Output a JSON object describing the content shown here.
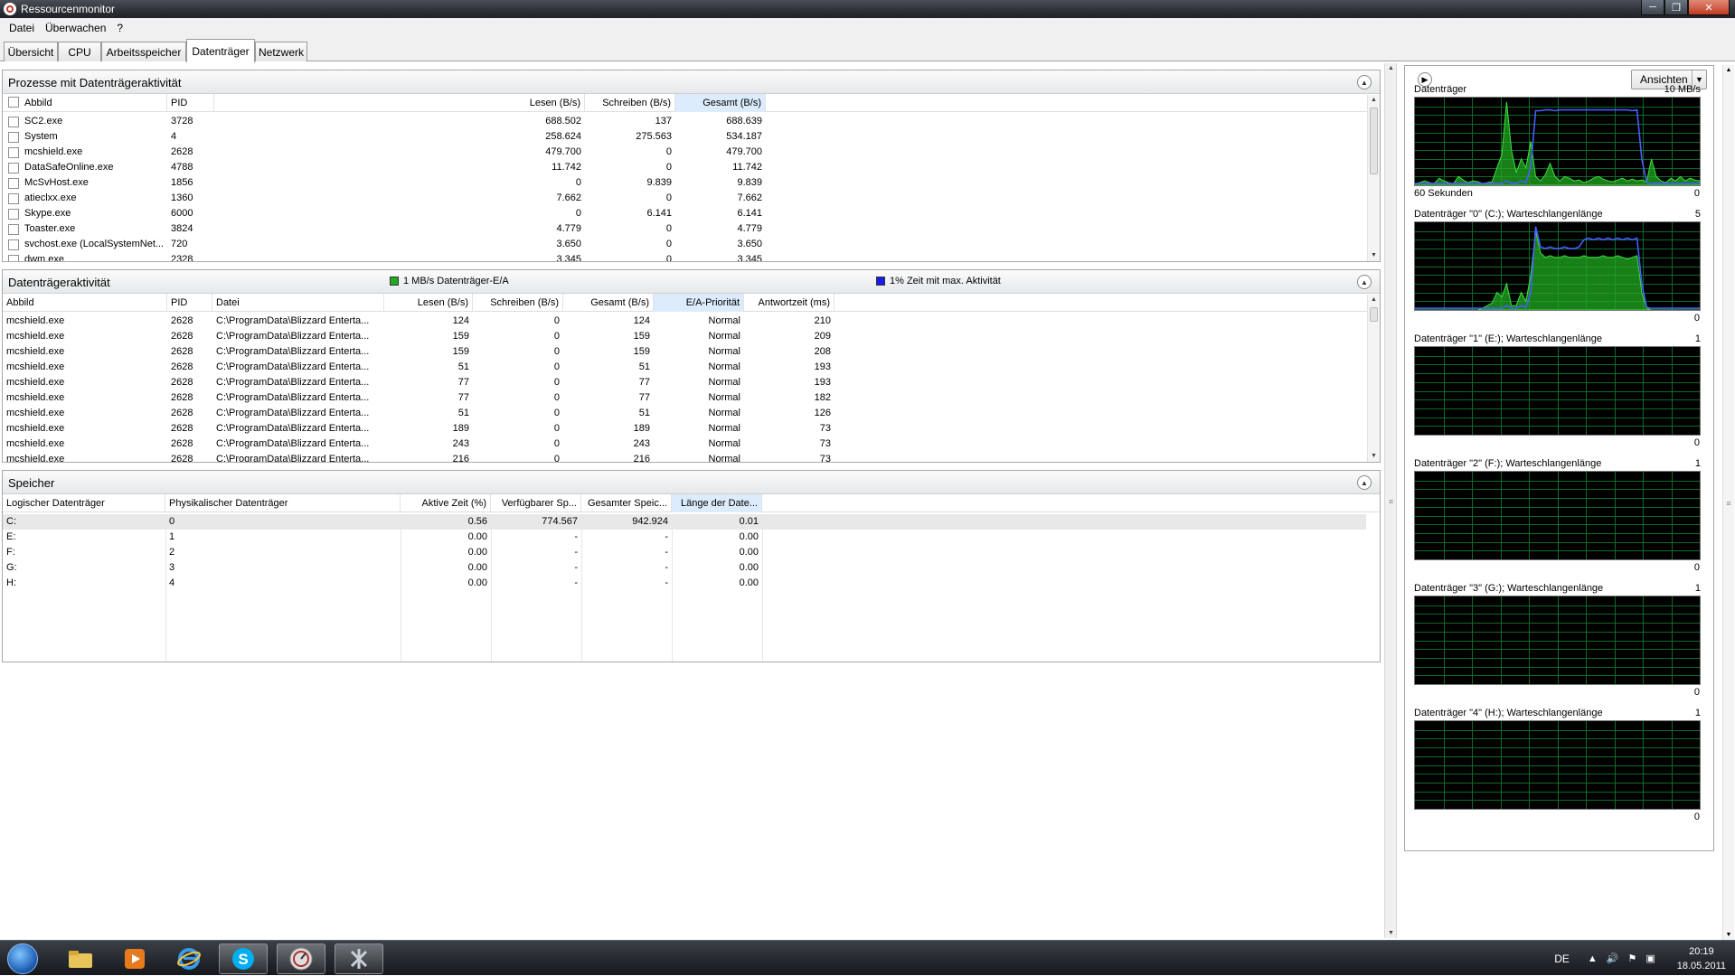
{
  "window": {
    "title": "Ressourcenmonitor"
  },
  "menu": [
    "Datei",
    "Überwachen",
    "?"
  ],
  "tabs": [
    {
      "label": "Übersicht",
      "active": false
    },
    {
      "label": "CPU",
      "active": false
    },
    {
      "label": "Arbeitsspeicher",
      "active": false
    },
    {
      "label": "Datenträger",
      "active": true
    },
    {
      "label": "Netzwerk",
      "active": false
    }
  ],
  "processes": {
    "title": "Prozesse mit Datenträgeraktivität",
    "columns": [
      "Abbild",
      "PID",
      "Lesen (B/s)",
      "Schreiben (B/s)",
      "Gesamt (B/s)"
    ],
    "rows": [
      {
        "name": "SC2.exe",
        "pid": "3728",
        "read": "688.502",
        "write": "137",
        "total": "688.639"
      },
      {
        "name": "System",
        "pid": "4",
        "read": "258.624",
        "write": "275.563",
        "total": "534.187"
      },
      {
        "name": "mcshield.exe",
        "pid": "2628",
        "read": "479.700",
        "write": "0",
        "total": "479.700"
      },
      {
        "name": "DataSafeOnline.exe",
        "pid": "4788",
        "read": "11.742",
        "write": "0",
        "total": "11.742"
      },
      {
        "name": "McSvHost.exe",
        "pid": "1856",
        "read": "0",
        "write": "9.839",
        "total": "9.839"
      },
      {
        "name": "atieclxx.exe",
        "pid": "1360",
        "read": "7.662",
        "write": "0",
        "total": "7.662"
      },
      {
        "name": "Skype.exe",
        "pid": "6000",
        "read": "0",
        "write": "6.141",
        "total": "6.141"
      },
      {
        "name": "Toaster.exe",
        "pid": "3824",
        "read": "4.779",
        "write": "0",
        "total": "4.779"
      },
      {
        "name": "svchost.exe (LocalSystemNet...",
        "pid": "720",
        "read": "3.650",
        "write": "0",
        "total": "3.650"
      },
      {
        "name": "dwm.exe",
        "pid": "2328",
        "read": "3.345",
        "write": "0",
        "total": "3.345"
      }
    ]
  },
  "activity": {
    "title": "Datenträgeraktivität",
    "legend_io": "1 MB/s Datenträger-E/A",
    "legend_active": "1% Zeit mit max. Aktivität",
    "color_io": "#22aa22",
    "color_active": "#1a1aee",
    "columns": [
      "Abbild",
      "PID",
      "Datei",
      "Lesen (B/s)",
      "Schreiben (B/s)",
      "Gesamt (B/s)",
      "E/A-Priorität",
      "Antwortzeit (ms)"
    ],
    "rows": [
      {
        "name": "mcshield.exe",
        "pid": "2628",
        "file": "C:\\ProgramData\\Blizzard Enterta...",
        "read": "124",
        "write": "0",
        "total": "124",
        "prio": "Normal",
        "resp": "210"
      },
      {
        "name": "mcshield.exe",
        "pid": "2628",
        "file": "C:\\ProgramData\\Blizzard Enterta...",
        "read": "159",
        "write": "0",
        "total": "159",
        "prio": "Normal",
        "resp": "209"
      },
      {
        "name": "mcshield.exe",
        "pid": "2628",
        "file": "C:\\ProgramData\\Blizzard Enterta...",
        "read": "159",
        "write": "0",
        "total": "159",
        "prio": "Normal",
        "resp": "208"
      },
      {
        "name": "mcshield.exe",
        "pid": "2628",
        "file": "C:\\ProgramData\\Blizzard Enterta...",
        "read": "51",
        "write": "0",
        "total": "51",
        "prio": "Normal",
        "resp": "193"
      },
      {
        "name": "mcshield.exe",
        "pid": "2628",
        "file": "C:\\ProgramData\\Blizzard Enterta...",
        "read": "77",
        "write": "0",
        "total": "77",
        "prio": "Normal",
        "resp": "193"
      },
      {
        "name": "mcshield.exe",
        "pid": "2628",
        "file": "C:\\ProgramData\\Blizzard Enterta...",
        "read": "77",
        "write": "0",
        "total": "77",
        "prio": "Normal",
        "resp": "182"
      },
      {
        "name": "mcshield.exe",
        "pid": "2628",
        "file": "C:\\ProgramData\\Blizzard Enterta...",
        "read": "51",
        "write": "0",
        "total": "51",
        "prio": "Normal",
        "resp": "126"
      },
      {
        "name": "mcshield.exe",
        "pid": "2628",
        "file": "C:\\ProgramData\\Blizzard Enterta...",
        "read": "189",
        "write": "0",
        "total": "189",
        "prio": "Normal",
        "resp": "73"
      },
      {
        "name": "mcshield.exe",
        "pid": "2628",
        "file": "C:\\ProgramData\\Blizzard Enterta...",
        "read": "243",
        "write": "0",
        "total": "243",
        "prio": "Normal",
        "resp": "73"
      },
      {
        "name": "mcshield.exe",
        "pid": "2628",
        "file": "C:\\ProgramData\\Blizzard Enterta...",
        "read": "216",
        "write": "0",
        "total": "216",
        "prio": "Normal",
        "resp": "73"
      }
    ]
  },
  "storage": {
    "title": "Speicher",
    "columns": [
      "Logischer Datenträger",
      "Physikalischer Datenträger",
      "Aktive Zeit (%)",
      "Verfügbarer Sp...",
      "Gesamter Speic...",
      "Länge der Date..."
    ],
    "rows": [
      {
        "logical": "C:",
        "physical": "0",
        "active": "0.56",
        "free": "774.567",
        "total": "942.924",
        "queue": "0.01"
      },
      {
        "logical": "E:",
        "physical": "1",
        "active": "0.00",
        "free": "-",
        "total": "-",
        "queue": "0.00"
      },
      {
        "logical": "F:",
        "physical": "2",
        "active": "0.00",
        "free": "-",
        "total": "-",
        "queue": "0.00"
      },
      {
        "logical": "G:",
        "physical": "3",
        "active": "0.00",
        "free": "-",
        "total": "-",
        "queue": "0.00"
      },
      {
        "logical": "H:",
        "physical": "4",
        "active": "0.00",
        "free": "-",
        "total": "-",
        "queue": "0.00"
      }
    ]
  },
  "sidebar": {
    "view_button": "Ansichten",
    "graphs": [
      {
        "title": "Datenträger",
        "max": "10 MB/s",
        "footer_left": "60 Sekunden",
        "footer_right": "0",
        "green": [
          0.02,
          0.03,
          0.05,
          0.03,
          0.02,
          0.08,
          0.05,
          0.03,
          0.02,
          0.1,
          0.06,
          0.03,
          0.05,
          0.04,
          0.02,
          0.03,
          0.04,
          0.2,
          0.35,
          0.95,
          0.4,
          0.15,
          0.3,
          0.2,
          0.5,
          0.1,
          0.05,
          0.12,
          0.25,
          0.1,
          0.05,
          0.1,
          0.08,
          0.05,
          0.06,
          0.03,
          0.05,
          0.08,
          0.1,
          0.07,
          0.05,
          0.04,
          0.06,
          0.08,
          0.05,
          0.07,
          0.05,
          0.06,
          0.04,
          0.3,
          0.1,
          0.05,
          0.03,
          0.08,
          0.05,
          0.1,
          0.05,
          0.08,
          0.06,
          0.05
        ],
        "blue": [
          0.02,
          0.02,
          0.02,
          0.02,
          0.02,
          0.02,
          0.02,
          0.02,
          0.02,
          0.02,
          0.02,
          0.02,
          0.02,
          0.02,
          0.02,
          0.02,
          0.02,
          0.02,
          0.02,
          0.05,
          0.02,
          0.02,
          0.05,
          0.03,
          0.2,
          0.85,
          0.85,
          0.86,
          0.86,
          0.85,
          0.86,
          0.86,
          0.86,
          0.86,
          0.86,
          0.86,
          0.86,
          0.86,
          0.86,
          0.86,
          0.86,
          0.86,
          0.86,
          0.86,
          0.86,
          0.85,
          0.86,
          0.3,
          0.03,
          0.02,
          0.02,
          0.02,
          0.02,
          0.02,
          0.02,
          0.02,
          0.02,
          0.02,
          0.02,
          0.02
        ]
      },
      {
        "title": "Datenträger \"0\" (C:); Warteschlangenlänge",
        "max": "5",
        "footer_left": "",
        "footer_right": "0",
        "green": [
          0,
          0,
          0,
          0,
          0,
          0,
          0,
          0,
          0,
          0,
          0,
          0,
          0,
          0,
          0.02,
          0.05,
          0.08,
          0.2,
          0.15,
          0.3,
          0.05,
          0.05,
          0.2,
          0.1,
          0.4,
          0.9,
          0.65,
          0.6,
          0.62,
          0.6,
          0.6,
          0.62,
          0.6,
          0.6,
          0.6,
          0.62,
          0.6,
          0.6,
          0.6,
          0.62,
          0.6,
          0.6,
          0.62,
          0.6,
          0.58,
          0.6,
          0.62,
          0.2,
          0.02,
          0,
          0,
          0,
          0,
          0,
          0,
          0,
          0,
          0,
          0,
          0
        ],
        "blue": [
          0.02,
          0.02,
          0.02,
          0.02,
          0.02,
          0.02,
          0.02,
          0.02,
          0.02,
          0.02,
          0.02,
          0.02,
          0.02,
          0.02,
          0.02,
          0.02,
          0.02,
          0.02,
          0.02,
          0.05,
          0.02,
          0.02,
          0.05,
          0.03,
          0.2,
          0.95,
          0.72,
          0.7,
          0.72,
          0.7,
          0.7,
          0.72,
          0.7,
          0.7,
          0.72,
          0.8,
          0.82,
          0.8,
          0.82,
          0.8,
          0.82,
          0.8,
          0.82,
          0.8,
          0.82,
          0.8,
          0.82,
          0.3,
          0.03,
          0.02,
          0.02,
          0.02,
          0.02,
          0.02,
          0.02,
          0.02,
          0.02,
          0.02,
          0.02,
          0.02
        ]
      },
      {
        "title": "Datenträger \"1\" (E:); Warteschlangenlänge",
        "max": "1",
        "footer_left": "",
        "footer_right": "0",
        "green": [],
        "blue": []
      },
      {
        "title": "Datenträger \"2\" (F:); Warteschlangenlänge",
        "max": "1",
        "footer_left": "",
        "footer_right": "0",
        "green": [],
        "blue": []
      },
      {
        "title": "Datenträger \"3\" (G:); Warteschlangenlänge",
        "max": "1",
        "footer_left": "",
        "footer_right": "0",
        "green": [],
        "blue": []
      },
      {
        "title": "Datenträger \"4\" (H:); Warteschlangenlänge",
        "max": "1",
        "footer_left": "",
        "footer_right": "0",
        "green": [],
        "blue": []
      }
    ]
  },
  "taskbar": {
    "apps": [
      "start-orb",
      "explorer",
      "media-player",
      "internet-explorer",
      "skype",
      "resource-monitor",
      "starcraft"
    ],
    "active_apps": [
      4,
      5,
      6
    ],
    "lang": "DE",
    "time": "20:19",
    "date": "18.05.2011"
  }
}
